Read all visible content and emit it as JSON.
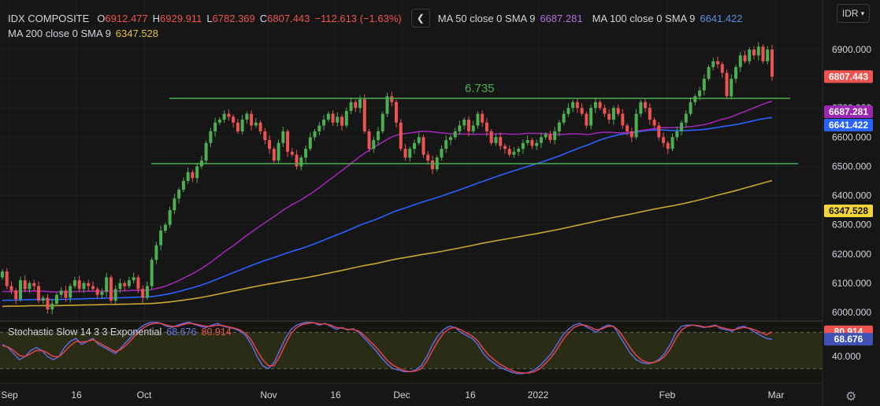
{
  "header": {
    "symbol": "IDX COMPOSITE",
    "o_label": "O",
    "o_value": "6912.477",
    "h_label": "H",
    "h_value": "6929.911",
    "l_label": "L",
    "l_value": "6782.369",
    "c_label": "C",
    "c_value": "6807.443",
    "change": "−112.613 (−1.63%)",
    "ma50_label": "MA 50 close 0 SMA 9",
    "ma50_value": "6687.281",
    "ma100_label": "MA 100 close 0 SMA 9",
    "ma100_value": "6641.422",
    "ma200_label": "MA 200 close 0 SMA 9",
    "ma200_value": "6347.528",
    "collapse_icon": "chevron-left-icon",
    "currency": "IDR",
    "currency_icon": "chevron-down-icon"
  },
  "colors": {
    "up": "#26a69a",
    "down": "#ef5350",
    "candle_up": "#4caf50",
    "candle_down": "#ef5350",
    "ma50": "#9c27b0",
    "ma100": "#2962ff",
    "ma200": "#c8a82a",
    "stoch_k": "#5b6be0",
    "stoch_d": "#e0454b",
    "trendline": "#4caf50"
  },
  "stoch": {
    "label": "Stochastic Slow 14 3 3 Exponential",
    "k_value": "68.676",
    "d_value": "80.914",
    "tick": "40.000"
  },
  "settings_icon": "gear-icon",
  "chart_data": [
    {
      "type": "candlestick",
      "title": "IDX COMPOSITE",
      "ylim": [
        5970,
        7000
      ],
      "yticks": [
        6000,
        6100,
        6200,
        6300,
        6400,
        6500,
        6600,
        6700,
        6800,
        6900
      ],
      "ytick_labels": [
        "6000.000",
        "6100.000",
        "6200.000",
        "6300.000",
        "6400.000",
        "6500.000",
        "6600.000",
        "6700.000",
        "6800.000",
        "6900.000"
      ],
      "xtick_labels": [
        "Sep",
        "16",
        "Oct",
        "Nov",
        "16",
        "Dec",
        "16",
        "2022",
        "Feb",
        "Mar"
      ],
      "close": [
        6140,
        6090,
        6075,
        6045,
        6110,
        6080,
        6100,
        6090,
        6040,
        6050,
        6010,
        6030,
        6060,
        6075,
        6050,
        6090,
        6110,
        6080,
        6100,
        6090,
        6080,
        6060,
        6070,
        6120,
        6040,
        6080,
        6100,
        6090,
        6110,
        6120,
        6080,
        6050,
        6090,
        6180,
        6230,
        6280,
        6300,
        6350,
        6390,
        6420,
        6450,
        6480,
        6460,
        6500,
        6520,
        6580,
        6620,
        6650,
        6660,
        6680,
        6670,
        6650,
        6620,
        6660,
        6680,
        6640,
        6650,
        6620,
        6590,
        6560,
        6520,
        6580,
        6620,
        6550,
        6540,
        6500,
        6530,
        6560,
        6600,
        6620,
        6640,
        6660,
        6680,
        6650,
        6670,
        6640,
        6690,
        6720,
        6700,
        6730,
        6620,
        6560,
        6590,
        6620,
        6680,
        6740,
        6720,
        6650,
        6560,
        6530,
        6560,
        6580,
        6600,
        6540,
        6520,
        6490,
        6530,
        6560,
        6590,
        6600,
        6620,
        6640,
        6660,
        6620,
        6640,
        6680,
        6650,
        6620,
        6580,
        6600,
        6570,
        6560,
        6540,
        6550,
        6560,
        6580,
        6590,
        6570,
        6580,
        6600,
        6610,
        6590,
        6620,
        6650,
        6680,
        6700,
        6720,
        6700,
        6680,
        6640,
        6700,
        6720,
        6700,
        6680,
        6660,
        6700,
        6680,
        6640,
        6620,
        6600,
        6680,
        6720,
        6700,
        6660,
        6640,
        6600,
        6580,
        6560,
        6600,
        6620,
        6650,
        6680,
        6720,
        6740,
        6760,
        6800,
        6840,
        6860,
        6850,
        6820,
        6740,
        6800,
        6840,
        6880,
        6860,
        6900,
        6880,
        6910,
        6860,
        6900,
        6807
      ]
    },
    {
      "type": "line",
      "title": "Stochastic Slow 14 3 3 Exponential",
      "ylim": [
        0,
        100
      ],
      "yticks": [
        40
      ],
      "ytick_labels": [
        "40.000"
      ],
      "reference_lines": [
        20,
        80
      ],
      "series": [
        {
          "name": "K",
          "values": [
            60,
            55,
            45,
            35,
            40,
            50,
            55,
            50,
            40,
            35,
            40,
            55,
            65,
            70,
            60,
            65,
            70,
            60,
            55,
            50,
            45,
            55,
            65,
            75,
            85,
            92,
            96,
            97,
            95,
            90,
            88,
            92,
            95,
            97,
            93,
            90,
            88,
            92,
            95,
            90,
            88,
            86,
            82,
            75,
            60,
            40,
            25,
            20,
            30,
            50,
            70,
            85,
            92,
            95,
            97,
            96,
            92,
            95,
            90,
            85,
            88,
            84,
            86,
            80,
            70,
            60,
            50,
            38,
            28,
            20,
            18,
            15,
            15,
            18,
            25,
            40,
            60,
            75,
            85,
            90,
            88,
            80,
            75,
            70,
            60,
            45,
            35,
            28,
            22,
            18,
            14,
            12,
            12,
            14,
            18,
            25,
            35,
            45,
            60,
            75,
            85,
            92,
            95,
            90,
            85,
            80,
            88,
            92,
            90,
            75,
            60,
            45,
            35,
            30,
            28,
            30,
            35,
            45,
            60,
            80,
            90,
            92,
            92,
            90,
            88,
            90,
            92,
            86,
            84,
            82,
            88,
            90,
            86,
            80,
            75,
            70,
            68.676
          ]
        },
        {
          "name": "D",
          "values": [
            58,
            56,
            50,
            42,
            40,
            45,
            50,
            50,
            46,
            40,
            40,
            48,
            58,
            65,
            64,
            65,
            68,
            63,
            58,
            53,
            48,
            52,
            60,
            70,
            80,
            88,
            93,
            95,
            95,
            92,
            90,
            90,
            93,
            95,
            94,
            92,
            90,
            90,
            92,
            91,
            89,
            87,
            84,
            78,
            67,
            50,
            35,
            25,
            25,
            40,
            60,
            78,
            88,
            93,
            95,
            96,
            94,
            94,
            92,
            88,
            87,
            85,
            85,
            82,
            74,
            65,
            56,
            45,
            34,
            26,
            21,
            17,
            15,
            16,
            20,
            32,
            50,
            66,
            79,
            86,
            88,
            84,
            79,
            74,
            66,
            53,
            42,
            34,
            27,
            22,
            17,
            14,
            13,
            13,
            15,
            20,
            29,
            39,
            52,
            67,
            79,
            88,
            92,
            92,
            88,
            84,
            86,
            90,
            90,
            82,
            68,
            54,
            42,
            34,
            30,
            30,
            33,
            40,
            52,
            70,
            84,
            90,
            92,
            91,
            89,
            89,
            91,
            88,
            86,
            84,
            86,
            88,
            87,
            84,
            80,
            76,
            80.914
          ]
        }
      ]
    }
  ]
}
